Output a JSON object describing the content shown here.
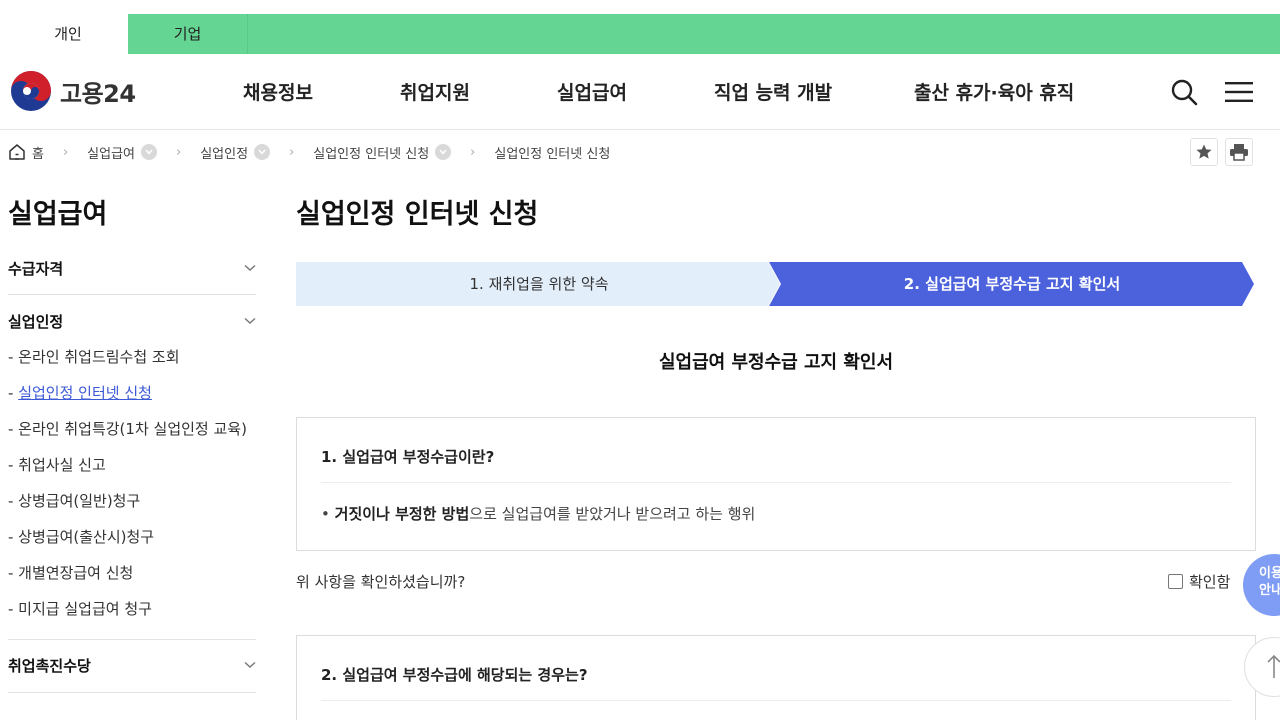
{
  "top_tabs": [
    "개인",
    "기업"
  ],
  "header": {
    "logo_text": "고용24",
    "nav": [
      "채용정보",
      "취업지원",
      "실업급여",
      "직업 능력 개발",
      "출산 휴가·육아 휴직"
    ]
  },
  "breadcrumb": [
    "홈",
    "실업급여",
    "실업인정",
    "실업인정 인터넷 신청",
    "실업인정 인터넷 신청"
  ],
  "sidebar": {
    "title": "실업급여",
    "sections": [
      "수급자격",
      "실업인정",
      "취업촉진수당"
    ],
    "sub_items": [
      "- 온라인 취업드림수첩 조회",
      "실업인정 인터넷 신청",
      "- 온라인 취업특강(1차 실업인정 교육)",
      "- 취업사실 신고",
      "- 상병급여(일반)청구",
      "- 상병급여(출산시)청구",
      "- 개별연장급여 신청",
      "- 미지급 실업급여 청구"
    ],
    "active_prefix": "- "
  },
  "main": {
    "page_title": "실업인정 인터넷 신청",
    "steps": [
      "1. 재취업을 위한 약속",
      "2. 실업급여 부정수급 고지 확인서"
    ],
    "heading": "실업급여 부정수급 고지 확인서",
    "box1": {
      "question": "1. 실업급여 부정수급이란?",
      "bullet": "•",
      "bold": "거짓이나 부정한 방법",
      "rest": "으로 실업급여를 받았거나 받으려고 하는 행위"
    },
    "confirm_question": "위 사항을 확인하셨습니까?",
    "confirm_label": "확인함",
    "box2": {
      "question": "2. 실업급여 부정수급에 해당되는 경우는?"
    }
  },
  "floating": {
    "guide_line1": "이용",
    "guide_line2": "안내"
  },
  "colors": {
    "top_bar": "#64d592",
    "step_inactive": "#e3eefb",
    "step_active": "#4c62dc",
    "link_active": "#3d5ad6"
  }
}
